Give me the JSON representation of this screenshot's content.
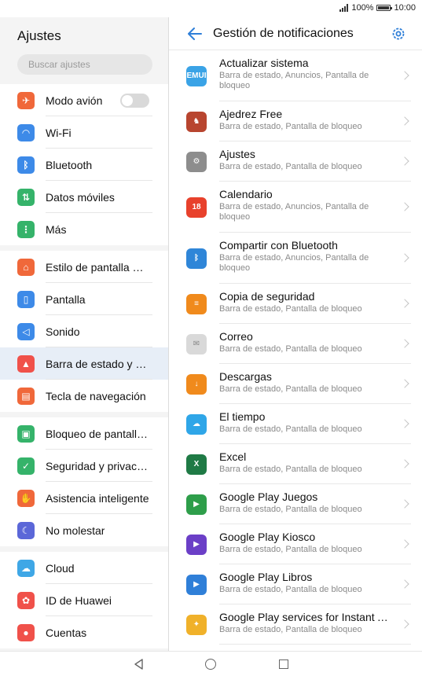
{
  "status": {
    "battery": "100%",
    "time": "10:00"
  },
  "left": {
    "title": "Ajustes",
    "search_placeholder": "Buscar ajustes",
    "groups": [
      [
        {
          "label": "Modo avión",
          "icon": "airplane-icon",
          "color": "#f0683a"
        },
        {
          "label": "Wi-Fi",
          "icon": "wifi-icon",
          "color": "#3d8ae8"
        },
        {
          "label": "Bluetooth",
          "icon": "bluetooth-icon",
          "color": "#3d8ae8"
        },
        {
          "label": "Datos móviles",
          "icon": "mobile-data-icon",
          "color": "#35b36a"
        },
        {
          "label": "Más",
          "icon": "more-icon",
          "color": "#35b36a"
        }
      ],
      [
        {
          "label": "Estilo de pantalla pri…",
          "icon": "home-screen-icon",
          "color": "#f0683a"
        },
        {
          "label": "Pantalla",
          "icon": "display-icon",
          "color": "#3d8ae8"
        },
        {
          "label": "Sonido",
          "icon": "sound-icon",
          "color": "#3d8ae8"
        },
        {
          "label": "Barra de estado y no…",
          "icon": "notification-bell-icon",
          "color": "#f0514a"
        },
        {
          "label": "Tecla de navegación",
          "icon": "navigation-key-icon",
          "color": "#f0683a"
        }
      ],
      [
        {
          "label": "Bloqueo de pantalla…",
          "icon": "lock-icon",
          "color": "#35b36a"
        },
        {
          "label": "Seguridad y privacid…",
          "icon": "shield-icon",
          "color": "#35b36a"
        },
        {
          "label": "Asistencia inteligente",
          "icon": "hand-icon",
          "color": "#f0683a"
        },
        {
          "label": "No molestar",
          "icon": "moon-icon",
          "color": "#5b67d8"
        }
      ],
      [
        {
          "label": "Cloud",
          "icon": "cloud-icon",
          "color": "#3fa7e6"
        },
        {
          "label": "ID de Huawei",
          "icon": "huawei-icon",
          "color": "#f0514a"
        },
        {
          "label": "Cuentas",
          "icon": "account-icon",
          "color": "#f0514a"
        }
      ]
    ]
  },
  "right": {
    "title": "Gestión de notificaciones",
    "apps": [
      {
        "name": "Actualizar sistema",
        "sub": "Barra de estado, Anuncios, Pantalla de bloqueo",
        "icon": "emui-icon",
        "color": "#3aa3e6",
        "glyph": "EMUI"
      },
      {
        "name": "Ajedrez Free",
        "sub": "Barra de estado, Pantalla de bloqueo",
        "icon": "chess-icon",
        "color": "#b8452f",
        "glyph": "♞"
      },
      {
        "name": "Ajustes",
        "sub": "Barra de estado, Pantalla de bloqueo",
        "icon": "settings-gear-icon",
        "color": "#8d8d8d",
        "glyph": "⚙"
      },
      {
        "name": "Calendario",
        "sub": "Barra de estado, Anuncios, Pantalla de bloqueo",
        "icon": "calendar-icon",
        "color": "#e8412c",
        "glyph": "18"
      },
      {
        "name": "Compartir con Bluetooth",
        "sub": "Barra de estado, Anuncios, Pantalla de bloqueo",
        "icon": "bluetooth-icon",
        "color": "#2f86d8",
        "glyph": "ᛒ"
      },
      {
        "name": "Copia de seguridad",
        "sub": "Barra de estado, Pantalla de bloqueo",
        "icon": "backup-icon",
        "color": "#f08a1c",
        "glyph": "≡"
      },
      {
        "name": "Correo",
        "sub": "Barra de estado, Pantalla de bloqueo",
        "icon": "mail-icon",
        "color": "#d9d9d9",
        "glyph": "✉"
      },
      {
        "name": "Descargas",
        "sub": "Barra de estado, Pantalla de bloqueo",
        "icon": "download-icon",
        "color": "#f08a1c",
        "glyph": "↓"
      },
      {
        "name": "El tiempo",
        "sub": "Barra de estado, Pantalla de bloqueo",
        "icon": "weather-icon",
        "color": "#2fa6e8",
        "glyph": "☁"
      },
      {
        "name": "Excel",
        "sub": "Barra de estado, Pantalla de bloqueo",
        "icon": "excel-icon",
        "color": "#1f7a45",
        "glyph": "X"
      },
      {
        "name": "Google Play Juegos",
        "sub": "Barra de estado, Pantalla de bloqueo",
        "icon": "play-games-icon",
        "color": "#2e9e4a",
        "glyph": "▶"
      },
      {
        "name": "Google Play Kiosco",
        "sub": "Barra de estado, Pantalla de bloqueo",
        "icon": "play-kiosk-icon",
        "color": "#6b3fc7",
        "glyph": "▶"
      },
      {
        "name": "Google Play Libros",
        "sub": "Barra de estado, Pantalla de bloqueo",
        "icon": "play-books-icon",
        "color": "#2f7fd8",
        "glyph": "▶"
      },
      {
        "name": "Google Play services for Instant Ap…",
        "sub": "Barra de estado, Pantalla de bloqueo",
        "icon": "play-services-icon",
        "color": "#f0b12a",
        "glyph": "✦"
      }
    ]
  }
}
